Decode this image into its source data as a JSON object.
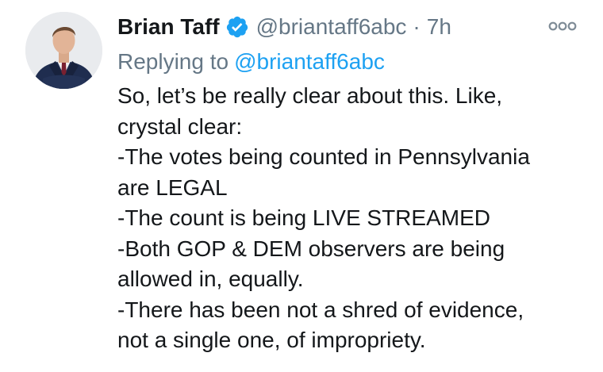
{
  "tweet": {
    "display_name": "Brian Taff",
    "verified_icon": "verified-badge-icon",
    "handle": "@briantaff6abc",
    "separator": "·",
    "time": "7h",
    "more_icon": "more-options-icon",
    "replying_to_prefix": "Replying to",
    "replying_to_handle": "@briantaff6abc",
    "body_lines": [
      "So, let’s be really clear about this. Like,",
      "crystal clear:",
      "-The votes being counted in Pennsylvania",
      "are LEGAL",
      "-The count is being LIVE STREAMED",
      "-Both GOP & DEM observers are being",
      "allowed in, equally.",
      "-There has been not a shred of evidence,",
      "not a single one, of impropriety."
    ]
  },
  "colors": {
    "text": "#14171a",
    "secondary": "#657786",
    "accent": "#1da1f2"
  }
}
